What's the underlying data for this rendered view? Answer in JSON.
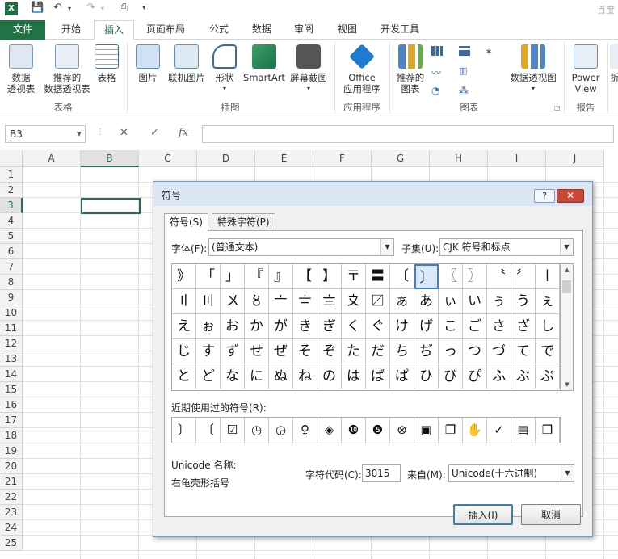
{
  "title_bar": {
    "app_logo": "X",
    "watermark": "百度"
  },
  "ribbon_tabs": [
    {
      "label": "文件"
    },
    {
      "label": "开始"
    },
    {
      "label": "插入"
    },
    {
      "label": "页面布局"
    },
    {
      "label": "公式"
    },
    {
      "label": "数据"
    },
    {
      "label": "审阅"
    },
    {
      "label": "视图"
    },
    {
      "label": "开发工具"
    }
  ],
  "ribbon": {
    "pivot_table": "数据\n透视表",
    "recommended_pivot": "推荐的\n数据透视表",
    "table": "表格",
    "group_tables": "表格",
    "picture": "图片",
    "online_picture": "联机图片",
    "shapes": "形状",
    "smartart": "SmartArt",
    "screenshot": "屏幕截图",
    "group_illustrations": "插图",
    "office_apps": "Office\n应用程序",
    "group_apps": "应用程序",
    "recommended_charts": "推荐的\n图表",
    "pivot_chart": "数据透视图",
    "group_charts": "图表",
    "power_view": "Power\nView",
    "group_reports": "报告",
    "truncated_next": "折"
  },
  "formula_bar": {
    "name_box": "B3",
    "cancel_icon": "✕",
    "enter_icon": "✓",
    "fx": "fx",
    "value": ""
  },
  "sheet": {
    "columns": [
      "A",
      "B",
      "C",
      "D",
      "E",
      "F",
      "G",
      "H",
      "I",
      "J"
    ],
    "rows": [
      "1",
      "2",
      "3",
      "4",
      "5",
      "6",
      "7",
      "8",
      "9",
      "10",
      "11",
      "12",
      "13",
      "14",
      "15",
      "16",
      "17",
      "18",
      "19",
      "20",
      "21",
      "22",
      "23",
      "24",
      "25"
    ],
    "selected_cell": "B3"
  },
  "dialog": {
    "title": "符号",
    "help": "?",
    "close": "✕",
    "tab_symbols": "符号(S)",
    "tab_special": "特殊字符(P)",
    "font_label": "字体(F):",
    "font_value": "(普通文本)",
    "subset_label": "子集(U):",
    "subset_value": "CJK 符号和标点",
    "symbols": [
      "》",
      "「",
      "」",
      "『",
      "』",
      "【",
      "】",
      "〒",
      "〓",
      "〔",
      "〕",
      "〖",
      "〗",
      "〝",
      "〞",
      "〡",
      "〢",
      "〣",
      "〤",
      "〥",
      "〦",
      "〧",
      "〨",
      "〩",
      "〼",
      "ぁ",
      "あ",
      "ぃ",
      "い",
      "ぅ",
      "う",
      "ぇ",
      "え",
      "ぉ",
      "お",
      "か",
      "が",
      "き",
      "ぎ",
      "く",
      "ぐ",
      "け",
      "げ",
      "こ",
      "ご",
      "さ",
      "ざ",
      "し",
      "じ",
      "す",
      "ず",
      "せ",
      "ぜ",
      "そ",
      "ぞ",
      "た",
      "だ",
      "ち",
      "ぢ",
      "っ",
      "つ",
      "づ",
      "て",
      "で",
      "と",
      "ど",
      "な",
      "に",
      "ぬ",
      "ね",
      "の",
      "は",
      "ば",
      "ぱ",
      "ひ",
      "び",
      "ぴ",
      "ふ",
      "ぶ",
      "ぷ"
    ],
    "selected_symbol": "〕",
    "recent_label": "近期使用过的符号(R):",
    "recent_symbols": [
      "〕",
      "〔",
      "☑",
      "◷",
      "◶",
      "♀",
      "◈",
      "❿",
      "❺",
      "⊗",
      "▣",
      "❐",
      "✋",
      "✓",
      "▤",
      "❒"
    ],
    "unicode_name_label": "Unicode 名称:",
    "unicode_name_value": "右龟壳形括号",
    "char_code_label": "字符代码(C):",
    "char_code_value": "3015",
    "from_label": "来自(M):",
    "from_value": "Unicode(十六进制)",
    "insert_button": "插入(I)",
    "cancel_button": "取消"
  }
}
